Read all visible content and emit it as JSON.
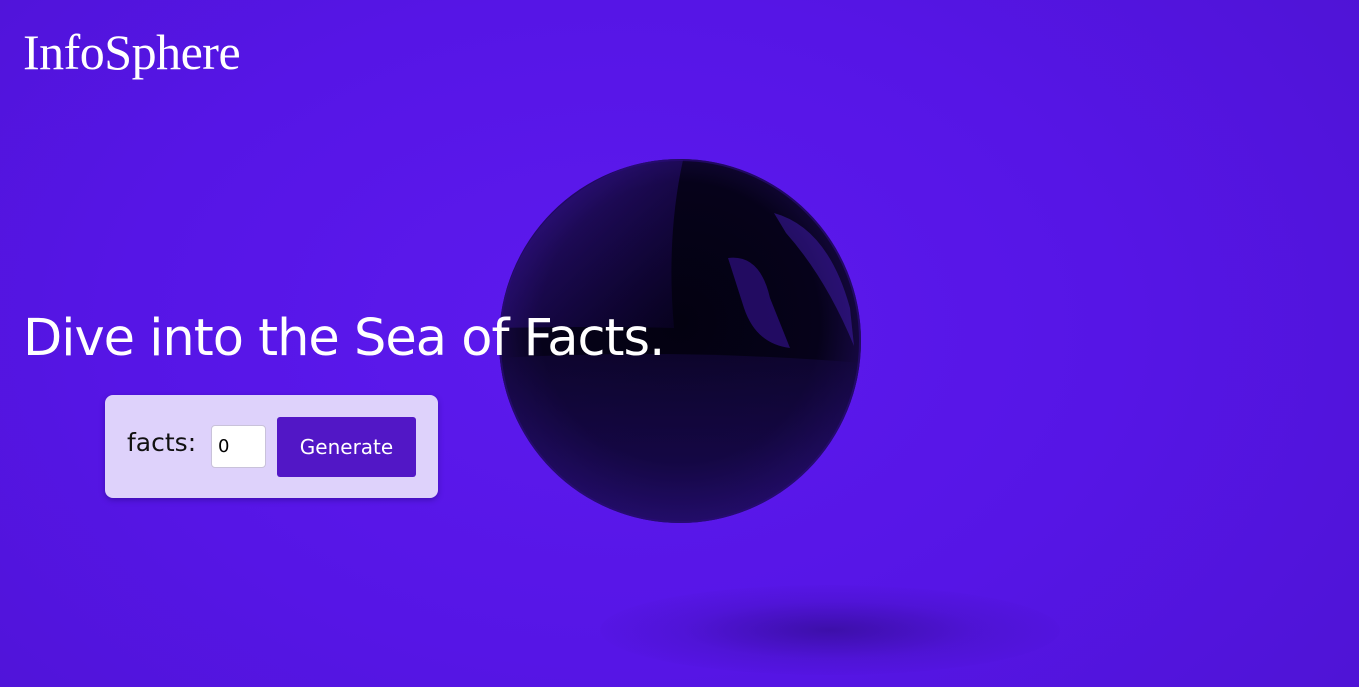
{
  "brand": {
    "name": "InfoSphere"
  },
  "hero": {
    "headline": "Dive into the Sea of Facts."
  },
  "controls": {
    "facts_label": "facts:",
    "facts_value": "0",
    "generate_label": "Generate"
  },
  "colors": {
    "background": "#5716e8",
    "card": "#ded2fb",
    "button": "#5217c6",
    "text_light": "#ffffff",
    "sphere": "#050214"
  },
  "graphics": {
    "sphere": "glossy-dark-sphere-graphic"
  }
}
